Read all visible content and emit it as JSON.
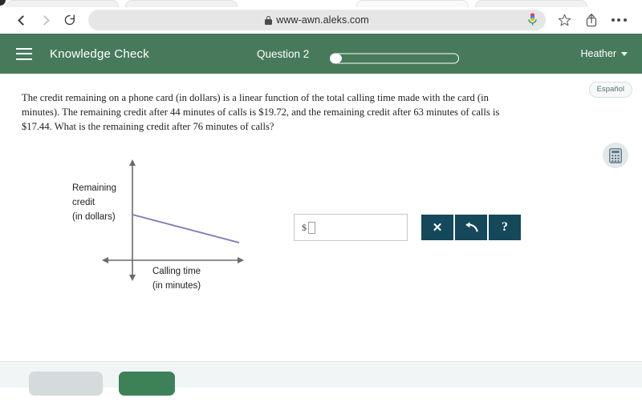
{
  "browser": {
    "back_icon": "chevron-left-icon",
    "forward_icon": "chevron-right-icon",
    "reload_icon": "reload-icon",
    "lock_icon": "lock-icon",
    "url": "www-awn.aleks.com",
    "mic_icon": "microphone-icon",
    "bookmark_icon": "star-icon",
    "share_icon": "share-icon",
    "more_icon": "more-options-icon",
    "tabs": [
      "",
      "",
      "",
      ""
    ]
  },
  "app_header": {
    "menu_icon": "hamburger-menu-icon",
    "title": "Knowledge Check",
    "question_label": "Question 2",
    "progress_percent": 8,
    "user_name": "Heather",
    "caret_icon": "chevron-down-icon",
    "background_color": "#477a5b"
  },
  "content": {
    "espanol_label": "Español",
    "calculator_icon": "calculator-icon",
    "question": {
      "line1": "The credit remaining on a phone card (in dollars) is a linear function of the total calling time made with the card (in",
      "line2": "minutes). The remaining credit after 44 minutes of calls is $19.72, and the remaining credit after 63 minutes of calls is",
      "line3": "$17.44. What is the remaining credit after 76 minutes of calls?"
    },
    "answer": {
      "currency_prefix": "$",
      "value": "",
      "clear_label": "✕",
      "undo_icon": "undo-arrow-icon",
      "help_label": "?",
      "button_color": "#14485a"
    }
  },
  "chart_data": {
    "type": "line",
    "title": "",
    "xlabel_line1": "Calling time",
    "xlabel_line2": "(in minutes)",
    "ylabel_line1": "Remaining",
    "ylabel_line2": "credit",
    "ylabel_line3": "(in dollars)",
    "series": [
      {
        "name": "remaining credit",
        "color": "#7b79b8",
        "x": [
          0,
          100
        ],
        "y": [
          62,
          36
        ]
      }
    ],
    "axis_color": "#6b6b6b",
    "grid": false,
    "legend": false,
    "xlim": [
      0,
      100
    ],
    "ylim": [
      0,
      100
    ],
    "tick_labels": []
  },
  "footer": {
    "secondary_button_label": "",
    "primary_button_label": "",
    "primary_color": "#3d8159"
  }
}
